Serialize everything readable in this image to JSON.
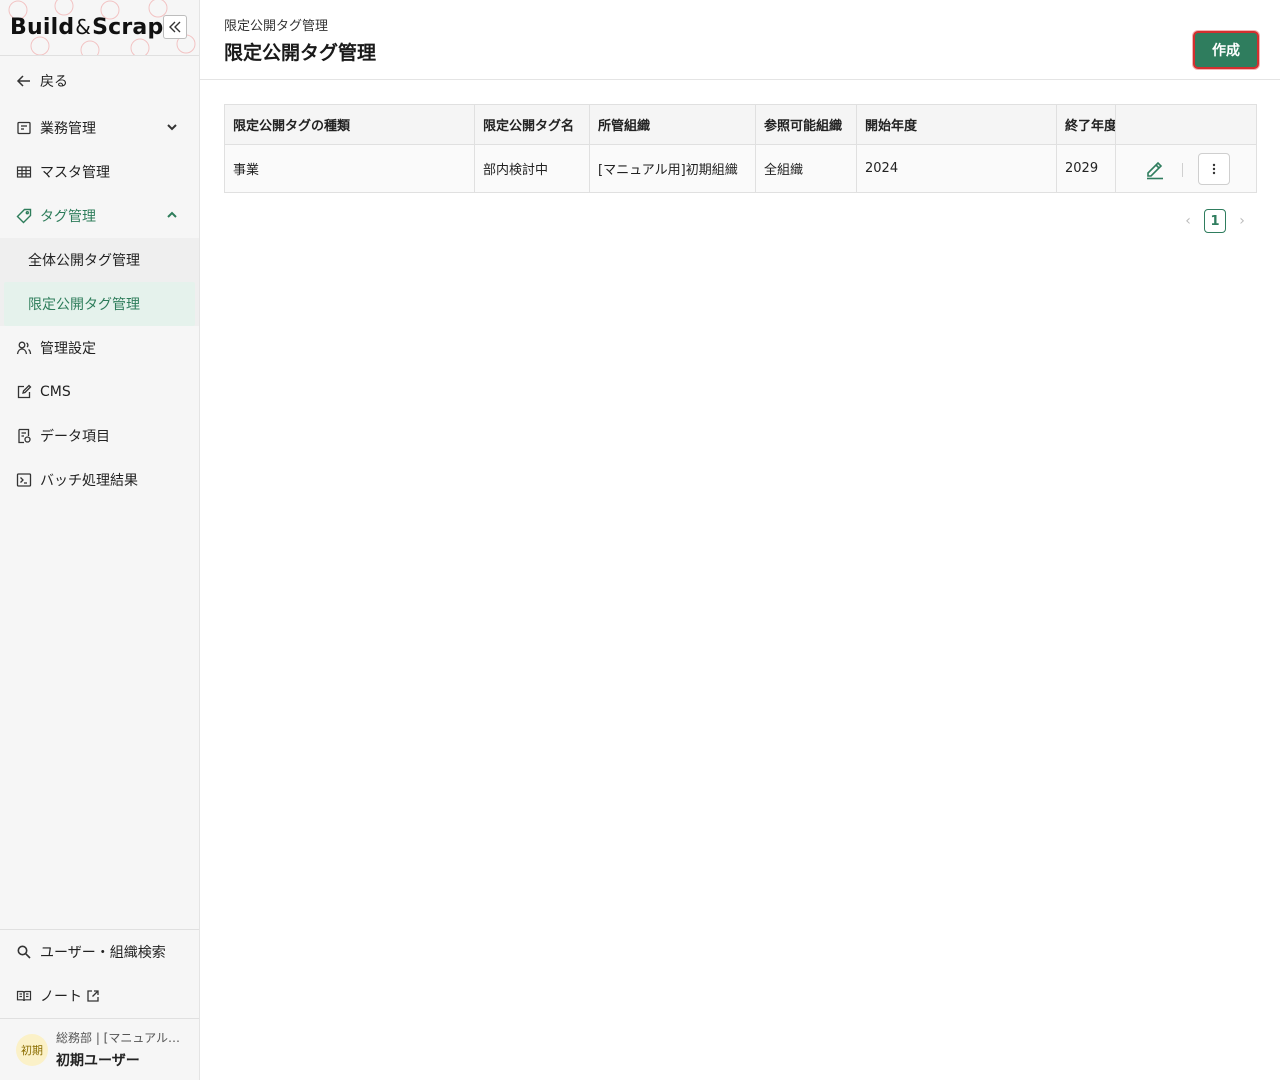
{
  "app": {
    "logo_left": "Build",
    "logo_amp": "&",
    "logo_right": "Scrap",
    "accent": "#2f7d5e"
  },
  "sidebar": {
    "back_label": "戻る",
    "items": [
      {
        "label": "業務管理",
        "icon": "form-icon",
        "chevron": "down"
      },
      {
        "label": "マスタ管理",
        "icon": "table-icon"
      },
      {
        "label": "タグ管理",
        "icon": "tag-icon",
        "chevron": "up"
      }
    ],
    "sub_items": [
      {
        "label": "全体公開タグ管理"
      },
      {
        "label": "限定公開タグ管理",
        "active": true
      }
    ],
    "items_after": [
      {
        "label": "管理設定",
        "icon": "users-icon"
      },
      {
        "label": "CMS",
        "icon": "edit-icon"
      },
      {
        "label": "データ項目",
        "icon": "document-icon"
      },
      {
        "label": "バッチ処理結果",
        "icon": "terminal-icon"
      }
    ],
    "bottom": [
      {
        "label": "ユーザー・組織検索",
        "icon": "search-icon"
      },
      {
        "label": "ノート",
        "icon": "book-icon"
      }
    ],
    "user": {
      "avatar_text": "初期",
      "org": "総務部 | [マニュアル用]初期組織",
      "name": "初期ユーザー"
    }
  },
  "header": {
    "breadcrumb": "限定公開タグ管理",
    "title": "限定公開タグ管理",
    "create_label": "作成"
  },
  "table": {
    "columns": [
      "限定公開タグの種類",
      "限定公開タグ名",
      "所管組織",
      "参照可能組織",
      "開始年度",
      "終了年度"
    ],
    "rows": [
      [
        "事業",
        "部内検討中",
        "[マニュアル用]初期組織",
        "全組織",
        "2024",
        "2029"
      ]
    ]
  },
  "pagination": {
    "current": "1",
    "prev": "‹",
    "next": "›"
  }
}
